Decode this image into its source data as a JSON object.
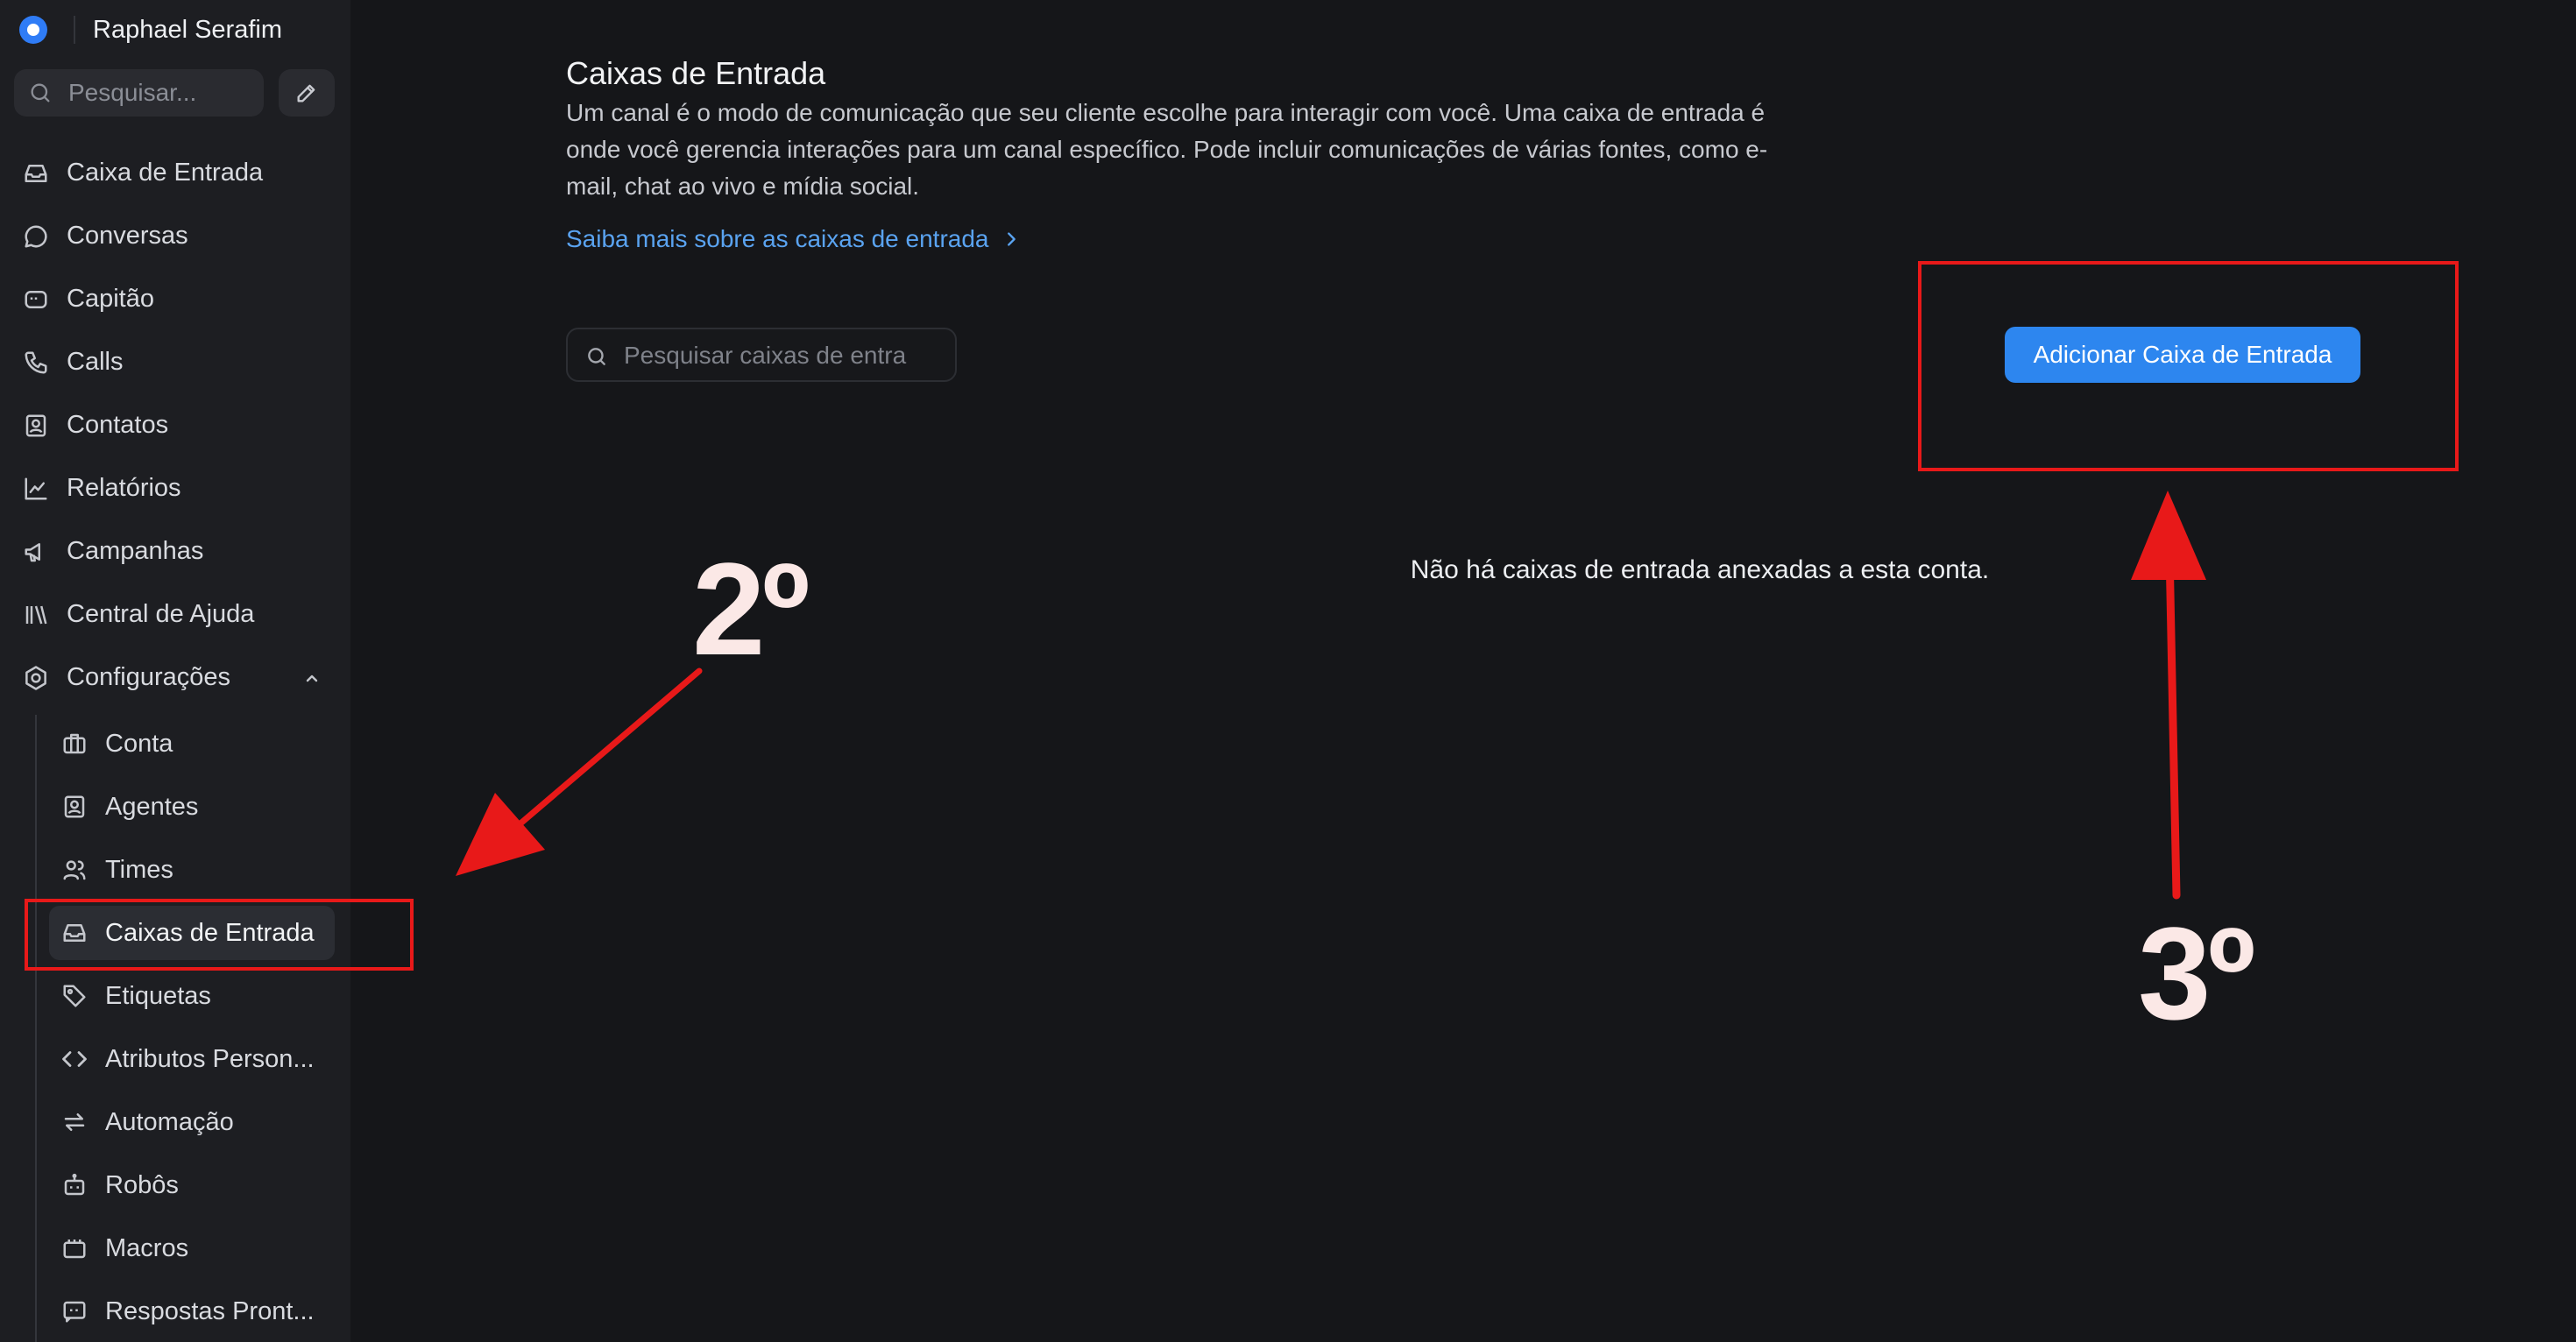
{
  "account": {
    "name": "Raphael Serafim"
  },
  "sidebar": {
    "search_placeholder": "Pesquisar...",
    "items": [
      {
        "label": "Caixa de Entrada",
        "icon": "inbox-icon"
      },
      {
        "label": "Conversas",
        "icon": "chat-bubble-icon"
      },
      {
        "label": "Capitão",
        "icon": "captain-icon"
      },
      {
        "label": "Calls",
        "icon": "phone-icon"
      },
      {
        "label": "Contatos",
        "icon": "contact-card-icon"
      },
      {
        "label": "Relatórios",
        "icon": "line-chart-icon"
      },
      {
        "label": "Campanhas",
        "icon": "megaphone-icon"
      },
      {
        "label": "Central de Ajuda",
        "icon": "library-icon"
      },
      {
        "label": "Configurações",
        "icon": "settings-icon",
        "expanded": true
      }
    ],
    "settings_items": [
      {
        "label": "Conta",
        "icon": "briefcase-icon"
      },
      {
        "label": "Agentes",
        "icon": "agent-icon"
      },
      {
        "label": "Times",
        "icon": "team-icon"
      },
      {
        "label": "Caixas de Entrada",
        "icon": "inbox-icon",
        "active": true
      },
      {
        "label": "Etiquetas",
        "icon": "tag-icon"
      },
      {
        "label": "Atributos Person...",
        "icon": "code-icon"
      },
      {
        "label": "Automação",
        "icon": "automation-icon"
      },
      {
        "label": "Robôs",
        "icon": "bot-icon"
      },
      {
        "label": "Macros",
        "icon": "macro-icon"
      },
      {
        "label": "Respostas Pront...",
        "icon": "canned-response-icon"
      }
    ]
  },
  "main": {
    "title": "Caixas de Entrada",
    "description": "Um canal é o modo de comunicação que seu cliente escolhe para interagir com você. Uma caixa de entrada é onde você gerencia interações para um canal específico. Pode incluir comunicações de várias fontes, como e-mail, chat ao vivo e mídia social.",
    "learn_more": "Saiba mais sobre as caixas de entrada",
    "search_placeholder": "Pesquisar caixas de entra",
    "add_button": "Adicionar Caixa de Entrada",
    "empty_message": "Não há caixas de entrada anexadas a esta conta."
  },
  "annotations": {
    "step2": "2º",
    "step3": "3º",
    "color": "#e81919"
  }
}
